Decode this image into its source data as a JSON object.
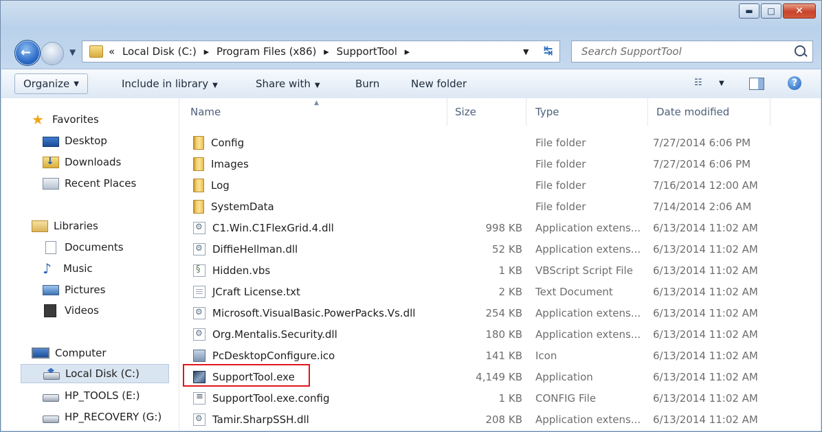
{
  "window": {
    "controls": {
      "minimize_glyph": "▬",
      "maximize_glyph": "□",
      "close_glyph": "✕"
    }
  },
  "address": {
    "overflow": "«",
    "crumbs": [
      "Local Disk (C:)",
      "Program Files (x86)",
      "SupportTool"
    ],
    "separator": "▸"
  },
  "search": {
    "placeholder": "Search SupportTool"
  },
  "toolbar": {
    "organize": "Organize",
    "include_in_library": "Include in library",
    "share_with": "Share with",
    "burn": "Burn",
    "new_folder": "New folder"
  },
  "navpane": {
    "favorites": "Favorites",
    "desktop": "Desktop",
    "downloads": "Downloads",
    "recent_places": "Recent Places",
    "libraries": "Libraries",
    "documents": "Documents",
    "music": "Music",
    "pictures": "Pictures",
    "videos": "Videos",
    "computer": "Computer",
    "local_disk": "Local Disk (C:)",
    "hp_tools": "HP_TOOLS (E:)",
    "hp_recovery": "HP_RECOVERY (G:)"
  },
  "columns": {
    "name": "Name",
    "size": "Size",
    "type": "Type",
    "date": "Date modified"
  },
  "files": [
    {
      "name": "Config",
      "size": "",
      "type": "File folder",
      "date": "7/27/2014 6:06 PM",
      "icon": "folder-icon"
    },
    {
      "name": "Images",
      "size": "",
      "type": "File folder",
      "date": "7/27/2014 6:06 PM",
      "icon": "folder-icon"
    },
    {
      "name": "Log",
      "size": "",
      "type": "File folder",
      "date": "7/16/2014 12:00 AM",
      "icon": "folder-icon"
    },
    {
      "name": "SystemData",
      "size": "",
      "type": "File folder",
      "date": "7/14/2014 2:06 AM",
      "icon": "folder-icon"
    },
    {
      "name": "C1.Win.C1FlexGrid.4.dll",
      "size": "998 KB",
      "type": "Application extens...",
      "date": "6/13/2014 11:02 AM",
      "icon": "dll-icon"
    },
    {
      "name": "DiffieHellman.dll",
      "size": "52 KB",
      "type": "Application extens...",
      "date": "6/13/2014 11:02 AM",
      "icon": "dll-icon"
    },
    {
      "name": "Hidden.vbs",
      "size": "1 KB",
      "type": "VBScript Script File",
      "date": "6/13/2014 11:02 AM",
      "icon": "vbs-icon"
    },
    {
      "name": "JCraft License.txt",
      "size": "2 KB",
      "type": "Text Document",
      "date": "6/13/2014 11:02 AM",
      "icon": "txt-icon"
    },
    {
      "name": "Microsoft.VisualBasic.PowerPacks.Vs.dll",
      "size": "254 KB",
      "type": "Application extens...",
      "date": "6/13/2014 11:02 AM",
      "icon": "dll-icon"
    },
    {
      "name": "Org.Mentalis.Security.dll",
      "size": "180 KB",
      "type": "Application extens...",
      "date": "6/13/2014 11:02 AM",
      "icon": "dll-icon"
    },
    {
      "name": "PcDesktopConfigure.ico",
      "size": "141 KB",
      "type": "Icon",
      "date": "6/13/2014 11:02 AM",
      "icon": "ico-icon"
    },
    {
      "name": "SupportTool.exe",
      "size": "4,149 KB",
      "type": "Application",
      "date": "6/13/2014 11:02 AM",
      "icon": "exe-icon"
    },
    {
      "name": "SupportTool.exe.config",
      "size": "1 KB",
      "type": "CONFIG File",
      "date": "6/13/2014 11:02 AM",
      "icon": "config-icon"
    },
    {
      "name": "Tamir.SharpSSH.dll",
      "size": "208 KB",
      "type": "Application extens...",
      "date": "6/13/2014 11:02 AM",
      "icon": "dll-icon"
    }
  ],
  "highlight_color": "#e0151c"
}
